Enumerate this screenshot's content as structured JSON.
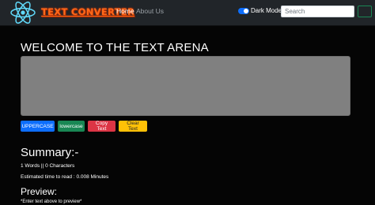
{
  "navbar": {
    "brand": "TEXT CONVERTER",
    "links": [
      "Home",
      "About Us"
    ],
    "dark_mode_label": "Dark Mode",
    "dark_mode_on": true,
    "search_placeholder": "Search"
  },
  "main": {
    "heading": "WELCOME TO THE TEXT ARENA",
    "textarea_value": "",
    "buttons": {
      "uppercase": "UPPERCASE",
      "lowercase": "lowercase",
      "copy": "Copy Text",
      "clear": "Clear Text"
    }
  },
  "summary": {
    "title": "Summary:-",
    "counts": "1 Words || 0 Characters",
    "read_time": "Estimated time to read : 0.008 Minutes"
  },
  "preview": {
    "title": "Preview:",
    "text": "*Enter text above to preview*"
  },
  "colors": {
    "navbar_bg": "#212529",
    "page_bg": "#050505",
    "brand": "#ff6a1a",
    "primary": "#0d6efd",
    "success": "#198754",
    "danger": "#dc3545",
    "warning": "#ffc107",
    "textarea_bg": "#808080"
  }
}
